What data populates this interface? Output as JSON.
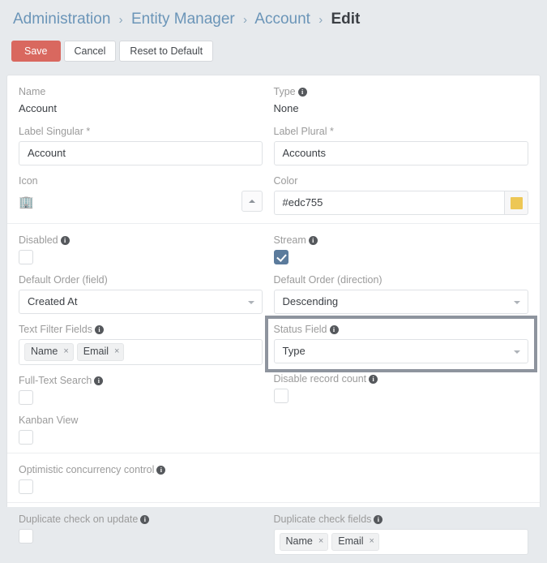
{
  "breadcrumb": {
    "separator": "›",
    "items": [
      {
        "label": "Administration",
        "current": false
      },
      {
        "label": "Entity Manager",
        "current": false
      },
      {
        "label": "Account",
        "current": false
      },
      {
        "label": "Edit",
        "current": true
      }
    ]
  },
  "toolbar": {
    "save_label": "Save",
    "cancel_label": "Cancel",
    "reset_label": "Reset to Default"
  },
  "colors": {
    "primary_button": "#d9685f",
    "accent_swatch": "#edc755",
    "checkbox_checked": "#5b7b9c",
    "highlight_border": "#8e949e",
    "breadcrumb_link": "#6b95b8"
  },
  "form": {
    "name": {
      "label": "Name",
      "value": "Account"
    },
    "type": {
      "label": "Type",
      "value": "None",
      "has_info": true
    },
    "label_singular": {
      "label": "Label Singular",
      "required": true,
      "value": "Account"
    },
    "label_plural": {
      "label": "Label Plural",
      "required": true,
      "value": "Accounts"
    },
    "icon": {
      "label": "Icon",
      "glyph": "🏢",
      "glyph_name": "building-emoji"
    },
    "color": {
      "label": "Color",
      "value": "#edc755",
      "swatch": "#edc755"
    },
    "disabled": {
      "label": "Disabled",
      "has_info": true,
      "checked": false
    },
    "stream": {
      "label": "Stream",
      "has_info": true,
      "checked": true
    },
    "default_order_field": {
      "label": "Default Order (field)",
      "value": "Created At"
    },
    "default_order_direction": {
      "label": "Default Order (direction)",
      "value": "Descending"
    },
    "text_filter_fields": {
      "label": "Text Filter Fields",
      "has_info": true,
      "tags": [
        "Name",
        "Email"
      ]
    },
    "status_field": {
      "label": "Status Field",
      "has_info": true,
      "value": "Type",
      "highlighted": true
    },
    "full_text_search": {
      "label": "Full-Text Search",
      "has_info": true,
      "checked": false
    },
    "disable_record_count": {
      "label": "Disable record count",
      "has_info": true,
      "checked": false
    },
    "kanban_view": {
      "label": "Kanban View",
      "has_info": false,
      "checked": false
    },
    "optimistic_concurrency": {
      "label": "Optimistic concurrency control",
      "has_info": true,
      "checked": false
    },
    "duplicate_check_on_update": {
      "label": "Duplicate check on update",
      "has_info": true,
      "checked": false
    },
    "duplicate_check_fields": {
      "label": "Duplicate check fields",
      "has_info": true,
      "tags": [
        "Name",
        "Email"
      ]
    }
  },
  "glyphs": {
    "info": "i",
    "tag_remove": "×",
    "required_mark": " *"
  }
}
